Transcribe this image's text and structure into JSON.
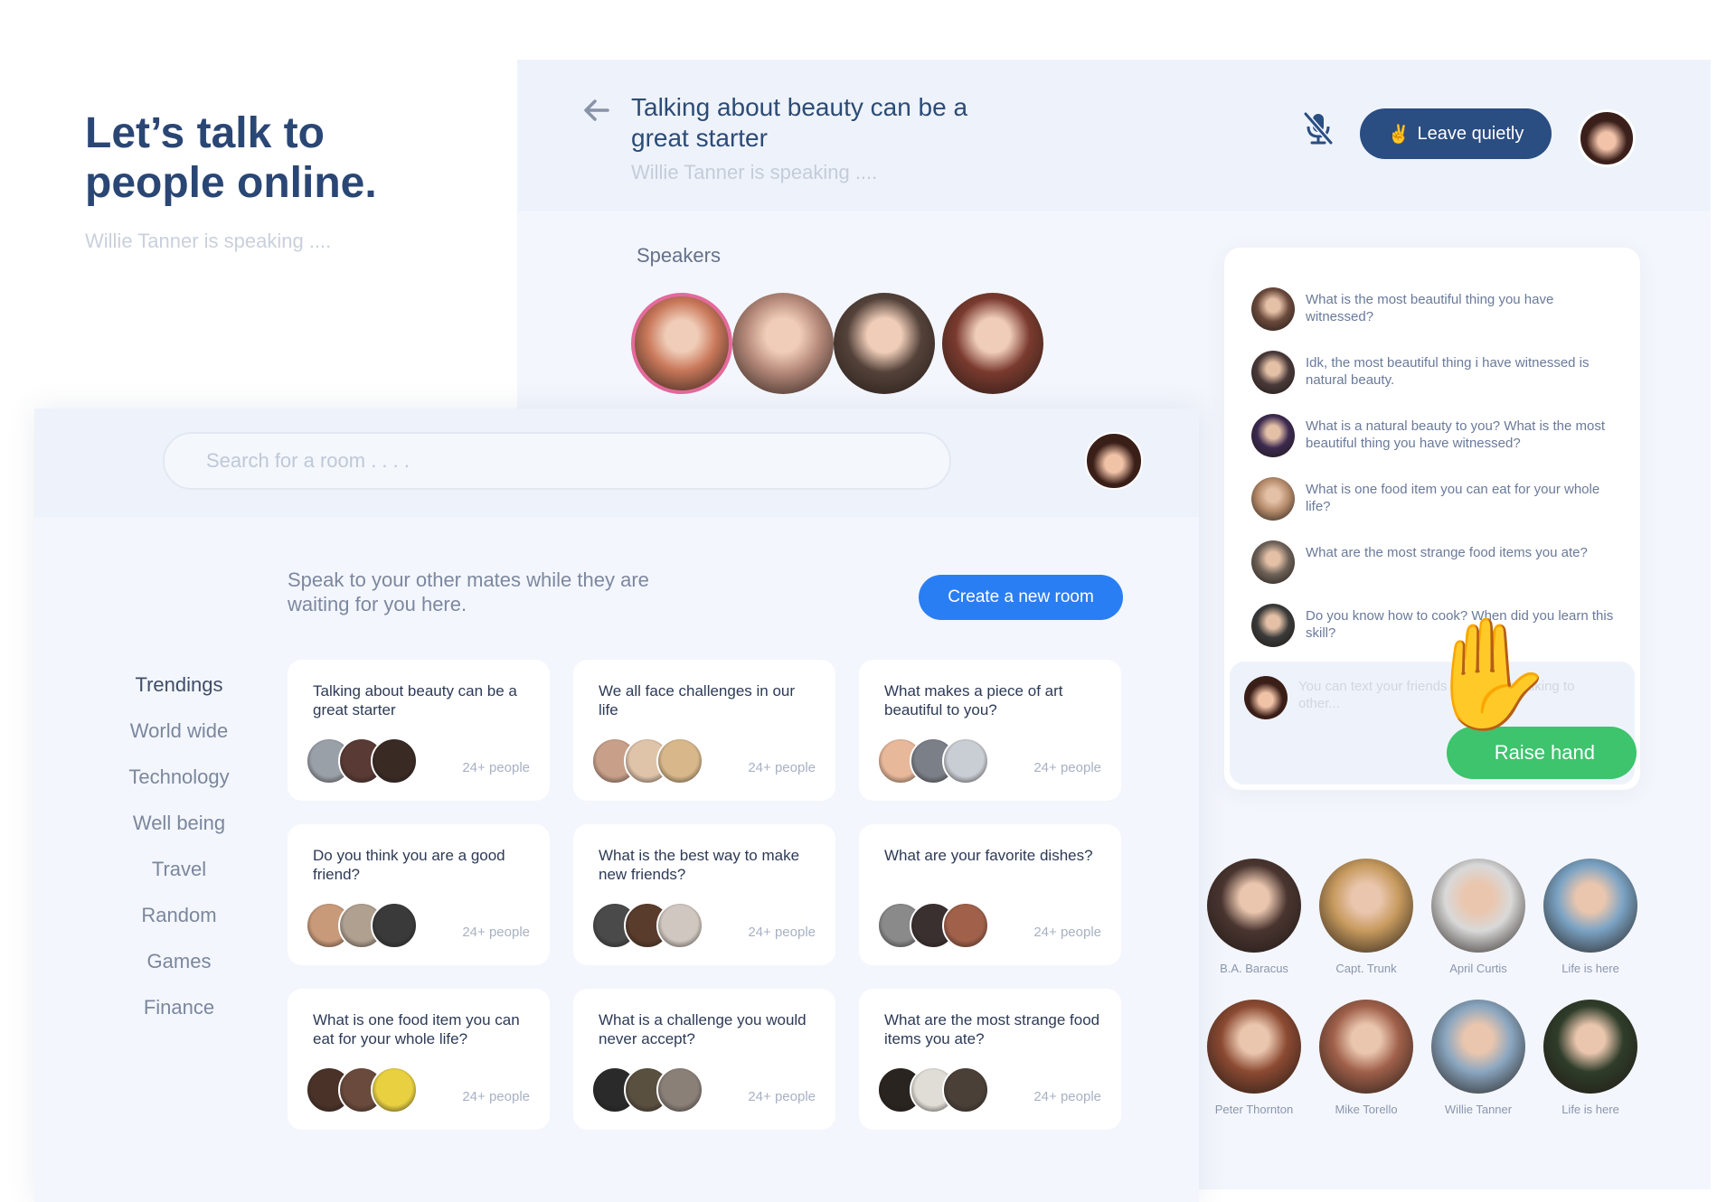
{
  "hero": {
    "title": "Let’s talk to people online.",
    "subtitle": "Willie Tanner is speaking ...."
  },
  "room": {
    "title": "Talking about beauty can be a great starter",
    "subtitle": "Willie Tanner is speaking ....",
    "leave_label": "Leave quietly",
    "leave_icon": "✌️",
    "speakers_label": "Speakers",
    "speaker_colors": [
      "#c9785a",
      "#b5897a",
      "#54423a",
      "#7a3a2e"
    ]
  },
  "chat": {
    "messages": [
      {
        "text": "What is the most beautiful thing you have witnessed?",
        "color": "#6b4a3c"
      },
      {
        "text": "Idk, the most beautiful thing i have witnessed is natural beauty.",
        "color": "#4a3a3a"
      },
      {
        "text": "What is a natural beauty to you? What is the most beautiful thing you have witnessed?",
        "color": "#3c2a50"
      },
      {
        "text": "What is one food item you can eat for your whole life?",
        "color": "#b48a6a"
      },
      {
        "text": "What are the most strange food items you ate?",
        "color": "#6e6258"
      },
      {
        "text": "Do you know how to cook? When did you learn this skill?",
        "color": "#3a3a3a"
      }
    ],
    "composer_placeholder": "You can text your friends while there talking to other...",
    "raise_hand_label": "Raise hand",
    "raise_hand_icon": "✋"
  },
  "audience": [
    {
      "name": "B.A. Baracus",
      "color": "#4a3530"
    },
    {
      "name": "Capt. Trunk",
      "color": "#c79a5e"
    },
    {
      "name": "April Curtis",
      "color": "#d9d9d9"
    },
    {
      "name": "Life is here",
      "color": "#7ba3c4"
    },
    {
      "name": "Peter Thornton",
      "color": "#8c4a32"
    },
    {
      "name": "Mike Torello",
      "color": "#a0604a"
    },
    {
      "name": "Willie Tanner",
      "color": "#8aa6c0"
    },
    {
      "name": "Life is here",
      "color": "#2f3d2a"
    }
  ],
  "lobby": {
    "search_placeholder": "Search for a room . . . .",
    "lead": "Speak to your other mates while they are waiting for you here.",
    "create_label": "Create a new room",
    "categories": [
      "Trendings",
      "World wide",
      "Technology",
      "Well being",
      "Travel",
      "Random",
      "Games",
      "Finance"
    ],
    "rooms": [
      {
        "title": "Talking about beauty can be a great starter",
        "count": "24+ people",
        "colors": [
          "#9aa0a8",
          "#5a3a34",
          "#3a2a24"
        ]
      },
      {
        "title": "We all face challenges in our life",
        "count": "24+ people",
        "colors": [
          "#c8a08a",
          "#e0c4aa",
          "#d8b88a"
        ]
      },
      {
        "title": "What makes a piece of art beautiful to you?",
        "count": "24+ people",
        "colors": [
          "#e8b89a",
          "#7a7f88",
          "#c9cdd4"
        ]
      },
      {
        "title": "Do you think you are a good friend?",
        "count": "24+ people",
        "colors": [
          "#c89a7a",
          "#b0a090",
          "#3a3a3a"
        ]
      },
      {
        "title": "What is the best way to make new friends?",
        "count": "24+ people",
        "colors": [
          "#4a4a4a",
          "#5a3c2c",
          "#d0c8c0"
        ]
      },
      {
        "title": "What are your favorite dishes?",
        "count": "24+ people",
        "colors": [
          "#8a8a8a",
          "#3a3030",
          "#a0604a"
        ]
      },
      {
        "title": "What is one food item you can eat for your whole life?",
        "count": "24+ people",
        "colors": [
          "#4a3228",
          "#6a4a3c",
          "#e8d040"
        ]
      },
      {
        "title": "What is a challenge you would never accept?",
        "count": "24+ people",
        "colors": [
          "#2a2a2a",
          "#5a5040",
          "#8a8078"
        ]
      },
      {
        "title": "What are the most strange food items you ate?",
        "count": "24+ people",
        "colors": [
          "#2a2420",
          "#e0dcd6",
          "#4a4038"
        ]
      }
    ]
  }
}
